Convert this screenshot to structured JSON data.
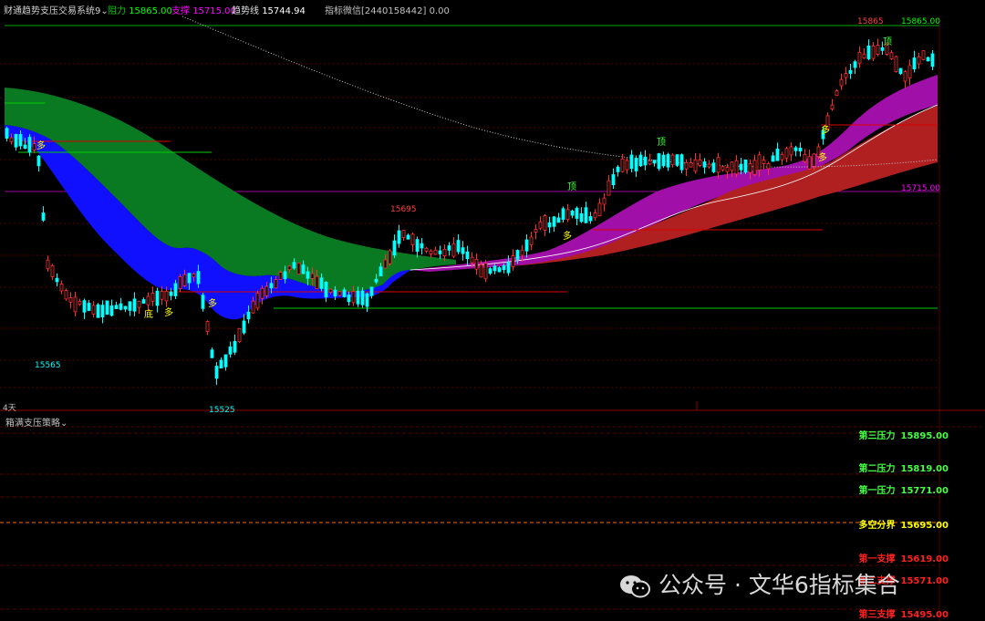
{
  "header": {
    "indicator_name": "财通趋势支压交易系统9",
    "resistance_label": "阻力",
    "resistance_value": "15865.00",
    "support_label": "支撑",
    "support_value": "15715.00",
    "trend_label": "趋势线",
    "trend_value": "15744.94",
    "contact_text": "指标微信[2440158442]",
    "contact_value": "0.00"
  },
  "period_label": "4天",
  "price_labels": {
    "high_left": "15695",
    "top_high": "15865",
    "low_1": "15565",
    "low_2": "15525",
    "right_resistance": "15865.00",
    "right_support": "15715.00"
  },
  "signals": {
    "duo": "多",
    "ding": "顶",
    "di": "底"
  },
  "sub_panel": {
    "title": "箱满支压策略",
    "levels": [
      {
        "label": "第三压力",
        "value": "15895.00",
        "color": "#44ff44"
      },
      {
        "label": "第二压力",
        "value": "15819.00",
        "color": "#44ff44"
      },
      {
        "label": "第一压力",
        "value": "15771.00",
        "color": "#44ff44"
      },
      {
        "label": "多空分界",
        "value": "15695.00",
        "color": "#ffff00"
      },
      {
        "label": "第一支撑",
        "value": "15619.00",
        "color": "#ff2020"
      },
      {
        "label": "第二支撑",
        "value": "15571.00",
        "color": "#ff2020"
      },
      {
        "label": "第三支撑",
        "value": "15495.00",
        "color": "#ff2020"
      }
    ]
  },
  "watermark": "公众号 · 文华6指标集合",
  "colors": {
    "up_candle": "#ff3030",
    "down_candle": "#00ffff",
    "green_cloud": "#0a7a22",
    "blue_cloud": "#1010ff",
    "purple_cloud": "#a010a8",
    "red_cloud": "#b02020",
    "resistance_line": "#00cc00",
    "support_line": "#cc00cc"
  }
}
